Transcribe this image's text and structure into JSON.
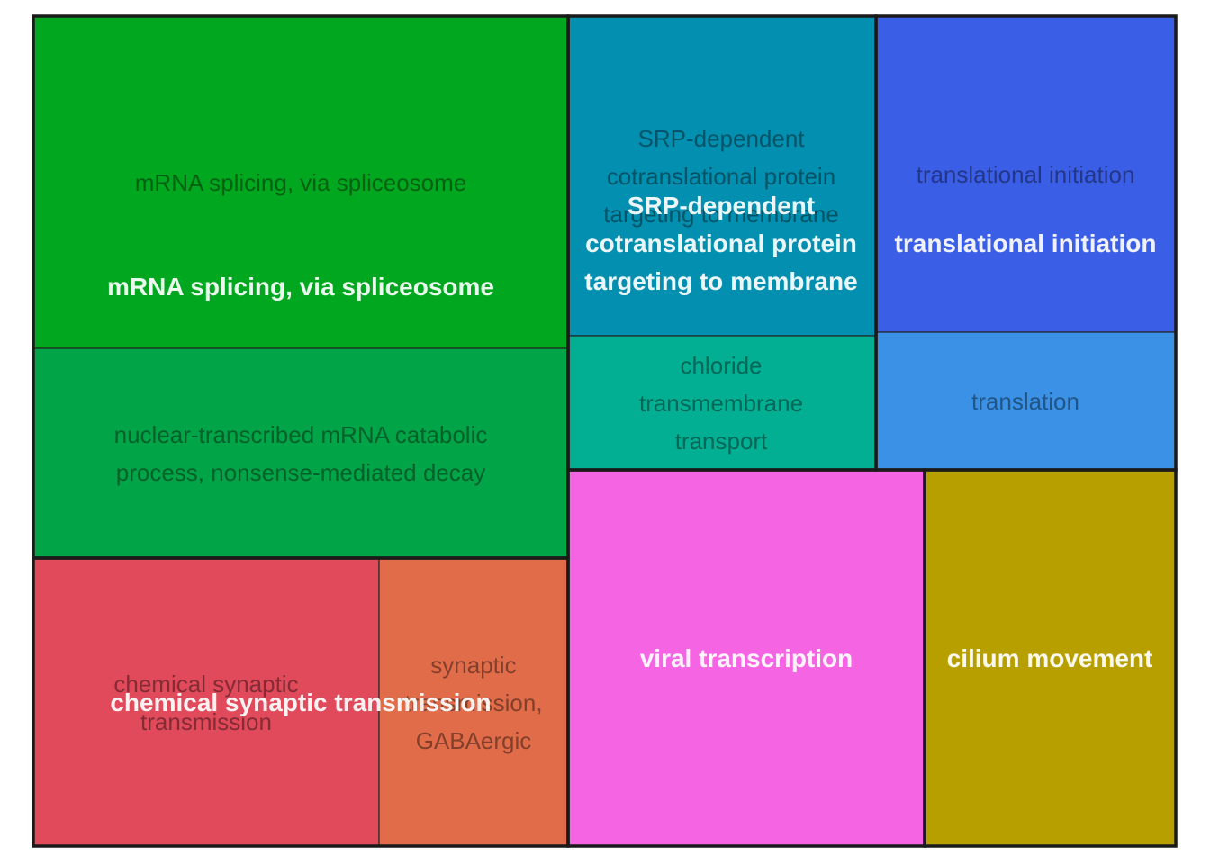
{
  "chart_data": {
    "type": "treemap",
    "groups": [
      {
        "name": "mRNA splicing, via spliceosome",
        "terms": [
          {
            "name": "mRNA splicing, via spliceosome",
            "lines": [
              "mRNA splicing, via spliceosome"
            ],
            "color": "#01A71E"
          },
          {
            "name": "nuclear-transcribed mRNA catabolic process, nonsense-mediated decay",
            "lines": [
              "nuclear-transcribed mRNA catabolic",
              "process, nonsense-mediated decay"
            ],
            "color": "#02A448"
          }
        ]
      },
      {
        "name": "SRP-dependent cotranslational protein targeting to membrane",
        "lines": [
          "SRP-dependent",
          "cotranslational protein",
          "targeting to membrane"
        ],
        "terms": [
          {
            "name": "SRP-dependent cotranslational protein targeting to membrane",
            "lines": [
              "SRP-dependent",
              "cotranslational protein",
              "targeting to membrane"
            ],
            "color": "#028FB0"
          },
          {
            "name": "chloride transmembrane transport",
            "lines": [
              "chloride",
              "transmembrane",
              "transport"
            ],
            "color": "#02AF93"
          }
        ]
      },
      {
        "name": "translational initiation",
        "terms": [
          {
            "name": "translational initiation",
            "lines": [
              "translational initiation"
            ],
            "color": "#3B5EE6"
          },
          {
            "name": "translation",
            "lines": [
              "translation"
            ],
            "color": "#3A91E5"
          }
        ]
      },
      {
        "name": "chemical synaptic transmission",
        "terms": [
          {
            "name": "chemical synaptic transmission",
            "lines": [
              "chemical synaptic",
              "transmission"
            ],
            "color": "#E04A5A"
          },
          {
            "name": "synaptic transmission, GABAergic",
            "lines": [
              "synaptic",
              "transmission,",
              "GABAergic"
            ],
            "color": "#E06C4A"
          }
        ]
      },
      {
        "name": "viral transcription",
        "terms": [
          {
            "name": "viral transcription",
            "lines": [
              "viral transcription"
            ],
            "color": "#F564E3"
          }
        ]
      },
      {
        "name": "cilium movement",
        "terms": [
          {
            "name": "cilium movement",
            "lines": [
              "cilium movement"
            ],
            "color": "#B79F00"
          }
        ]
      }
    ]
  }
}
